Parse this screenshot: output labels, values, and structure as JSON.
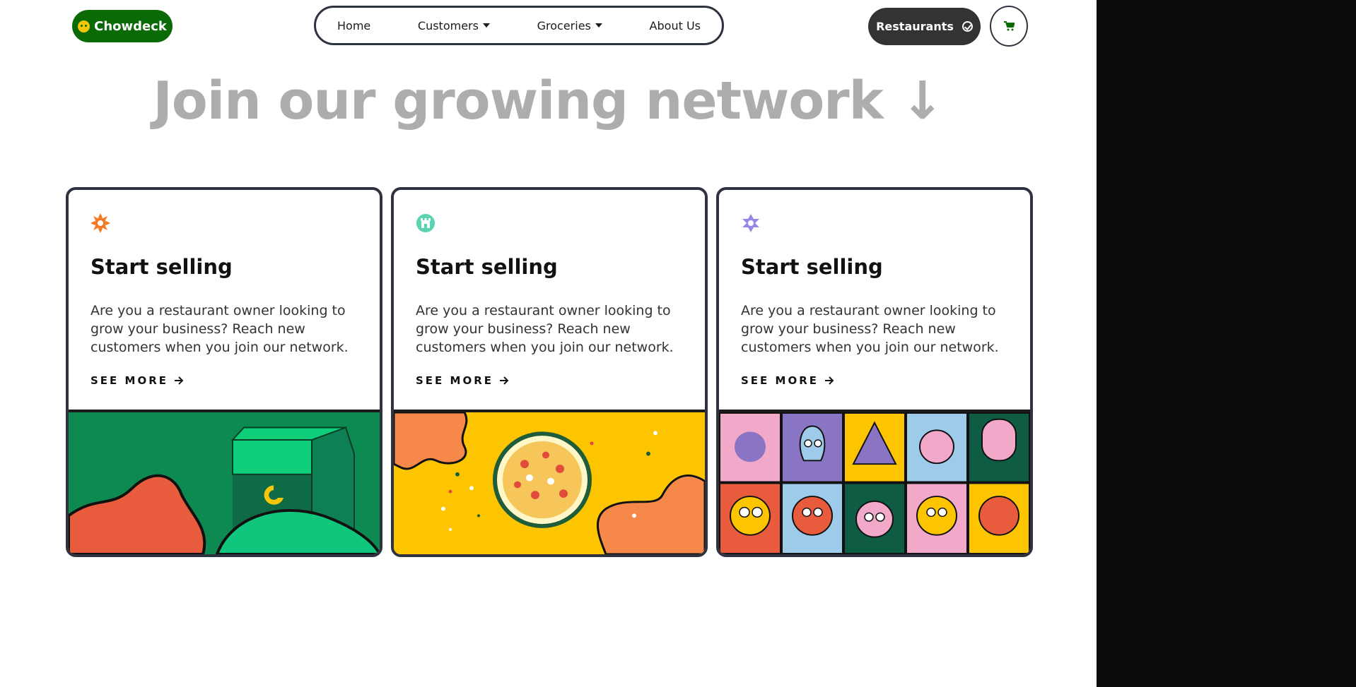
{
  "brand": {
    "name": "Chowdeck",
    "color": "#0a6a06"
  },
  "nav": {
    "items": [
      {
        "label": "Home",
        "dropdown": false
      },
      {
        "label": "Customers",
        "dropdown": true
      },
      {
        "label": "Groceries",
        "dropdown": true
      },
      {
        "label": "About Us",
        "dropdown": false
      }
    ]
  },
  "header": {
    "restaurants_label": "Restaurants",
    "cart_icon": "cart-icon"
  },
  "hero": {
    "title": "Join our growing network ↓"
  },
  "cards": [
    {
      "icon": "sun-icon",
      "icon_color": "#f07a22",
      "title": "Start selling",
      "text": "Are you a restaurant owner looking to grow your business? Reach new customers when you join our network.",
      "link": "SEE MORE",
      "illustration": "delivery-box-illustration"
    },
    {
      "icon": "castle-icon",
      "icon_color": "#5ad4b0",
      "title": "Start selling",
      "text": "Are you a restaurant owner looking to grow your business? Reach new customers when you join our network.",
      "link": "SEE MORE",
      "illustration": "pizza-illustration"
    },
    {
      "icon": "star-icon",
      "icon_color": "#9a86e8",
      "title": "Start selling",
      "text": "Are you a restaurant owner looking to grow your business? Reach new customers when you join our network.",
      "link": "SEE MORE",
      "illustration": "characters-grid-illustration"
    }
  ]
}
